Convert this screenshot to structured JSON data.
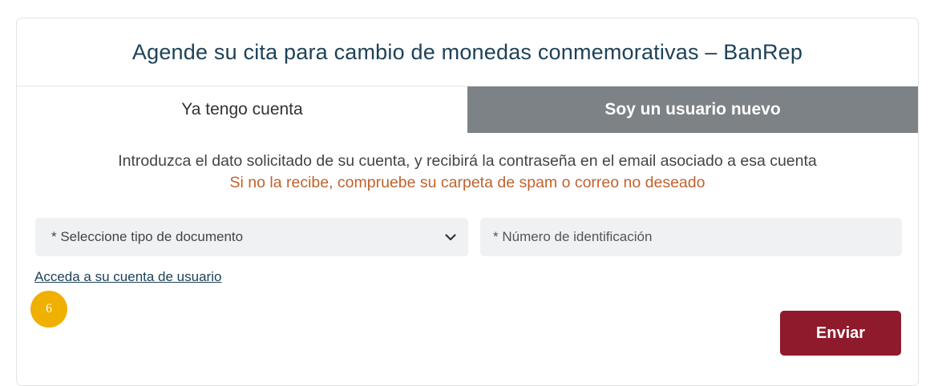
{
  "header": {
    "title": "Agende su cita para cambio de monedas conmemorativas – BanRep"
  },
  "tabs": [
    {
      "label": "Ya tengo cuenta",
      "active": true
    },
    {
      "label": "Soy un usuario nuevo",
      "active": false
    }
  ],
  "instructions": {
    "main": "Introduzca el dato solicitado de su cuenta, y recibirá la contraseña en el email asociado a esa cuenta",
    "warning": "Si no la recibe, compruebe su carpeta de spam o correo no deseado"
  },
  "form": {
    "document_type": {
      "selected": "* Seleccione tipo de documento",
      "icon": "chevron-down-icon"
    },
    "id_number": {
      "placeholder": "* Número de identificación",
      "value": ""
    },
    "account_link": "Acceda a su cuenta de usuario",
    "submit_label": "Enviar"
  },
  "annotation": {
    "step_number": "6"
  },
  "colors": {
    "title_text": "#1e4258",
    "tab_inactive_bg": "#7c8286",
    "warning_text": "#c0622e",
    "submit_bg": "#8e1a2b",
    "badge_bg": "#f0b000",
    "input_bg": "#f0f1f2"
  }
}
